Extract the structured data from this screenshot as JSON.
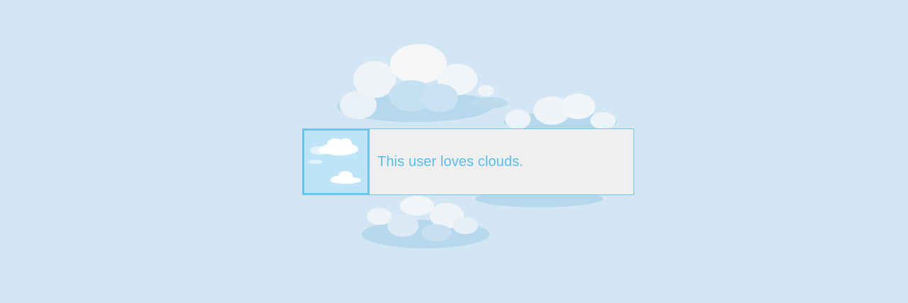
{
  "userbox": {
    "text": "This user loves clouds.",
    "icon": "cloud-icon"
  },
  "colors": {
    "background": "#d3e6f3",
    "accent": "#6cc6ec",
    "text": "#5bbde6",
    "panel": "#efefef",
    "cloud_light": "#f3f6f8",
    "cloud_shadow": "#b5d8ed"
  }
}
